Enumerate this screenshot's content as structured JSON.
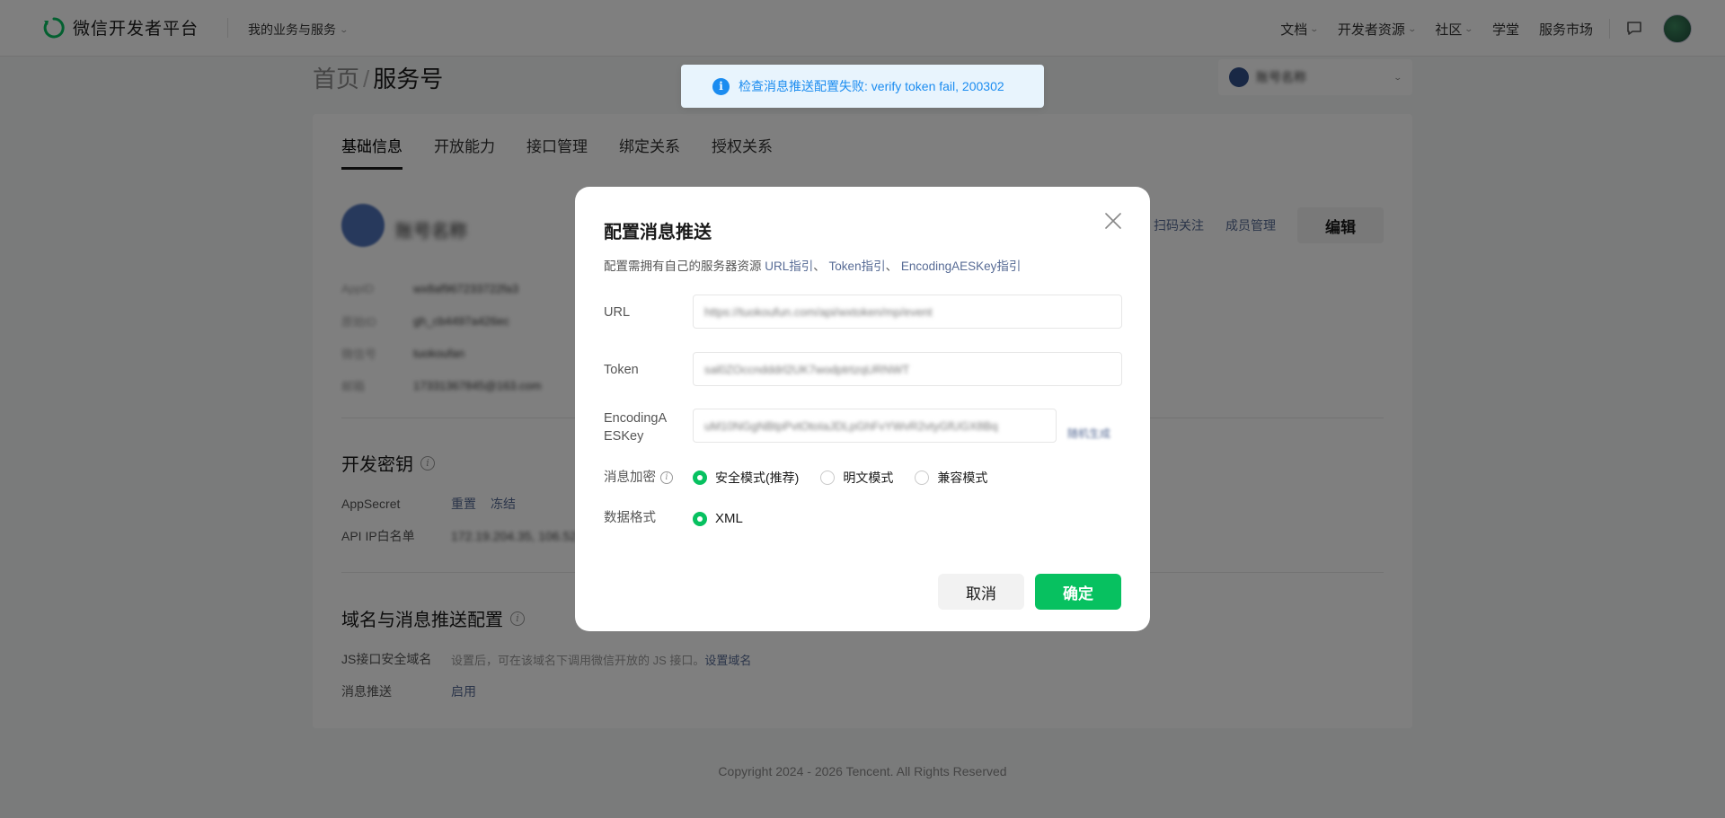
{
  "topbar": {
    "logo_text": "微信开发者平台",
    "service_menu": "我的业务与服务",
    "nav": [
      {
        "label": "文档",
        "has_dropdown": true
      },
      {
        "label": "开发者资源",
        "has_dropdown": true
      },
      {
        "label": "社区",
        "has_dropdown": true
      },
      {
        "label": "学堂",
        "has_dropdown": false
      },
      {
        "label": "服务市场",
        "has_dropdown": false
      }
    ],
    "icons": [
      "message-icon",
      "avatar"
    ]
  },
  "breadcrumb": {
    "home": "首页",
    "separator": "/",
    "current": "服务号"
  },
  "account_selector": {
    "name": "账号名称"
  },
  "tabs": [
    "基础信息",
    "开放能力",
    "接口管理",
    "绑定关系",
    "授权关系"
  ],
  "profile": {
    "name": "账号名称",
    "actions": [
      "扫码关注",
      "成员管理"
    ],
    "edit_label": "编辑",
    "info": [
      {
        "label": "AppID",
        "value": "wx8af967233722fa3"
      },
      {
        "label": "原始ID",
        "value": "gh_cb4497a426ec"
      },
      {
        "label": "微信号",
        "value": "tuokoufan"
      },
      {
        "label": "邮箱",
        "value": "17331367845@163.com"
      }
    ]
  },
  "dev_key": {
    "title": "开发密钥",
    "appsecret_label": "AppSecret",
    "appsecret_actions": [
      "重置",
      "冻结"
    ],
    "ip_label": "API IP白名单",
    "ip_value": "172.19.204.35, 106.52..."
  },
  "domain_push": {
    "title": "域名与消息推送配置",
    "js_label": "JS接口安全域名",
    "js_desc": "设置后，可在该域名下调用微信开放的 JS 接口。",
    "js_link": "设置域名",
    "push_label": "消息推送",
    "push_value": "启用"
  },
  "footer": "Copyright 2024 - 2026 Tencent. All Rights Reserved",
  "toast": {
    "type": "info",
    "message": "检查消息推送配置失败: verify token fail, 200302"
  },
  "dialog": {
    "title": "配置消息推送",
    "desc_prefix": "配置需拥有自己的服务器资源",
    "links": [
      "URL指引",
      "Token指引",
      "EncodingAESKey指引"
    ],
    "link_sep": "、",
    "url_label": "URL",
    "url_value": "https://tuokoufun.com/api/wxtoken/mp/event",
    "token_label": "Token",
    "token_value": "sal0ZOccndddrl2UK7wodptrtzqURNWT",
    "aes_label_1": "EncodingA",
    "aes_label_2": "ESKey",
    "aes_value": "uM10NGgNBtpPvtOtoIaJDLpGhFvYWvR2vtyGfUGX8Bq",
    "aes_generate": "随机生成",
    "encrypt_label": "消息加密",
    "encrypt_options": [
      {
        "label": "安全模式(推荐)",
        "checked": true
      },
      {
        "label": "明文模式",
        "checked": false
      },
      {
        "label": "兼容模式",
        "checked": false
      }
    ],
    "format_label": "数据格式",
    "format_options": [
      {
        "label": "XML",
        "checked": true
      }
    ],
    "cancel_label": "取消",
    "ok_label": "确定"
  },
  "colors": {
    "accent": "#07c160",
    "link": "#576b95",
    "toast": "#1b8cf0",
    "mask": "rgba(0,0,0,0.5)"
  }
}
